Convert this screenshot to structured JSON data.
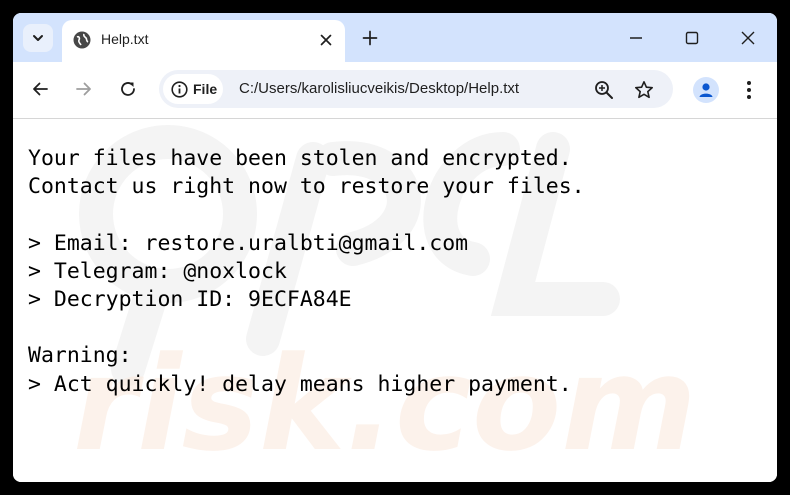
{
  "tab": {
    "title": "Help.txt",
    "icon": "globe-icon"
  },
  "address_bar": {
    "security_chip": "File",
    "url": "C:/Users/karolisliucveikis/Desktop/Help.txt"
  },
  "document": {
    "lines": [
      "Your files have been stolen and encrypted.",
      "Contact us right now to restore your files.",
      "",
      "> Email: restore.uralbti@gmail.com",
      "> Telegram: @noxlock",
      "> Decryption ID: 9ECFA84E",
      "",
      "Warning:",
      "> Act quickly! delay means higher payment."
    ]
  },
  "watermark": {
    "text": "risk.com"
  },
  "colors": {
    "tabstrip_bg": "#d3e3fd",
    "omnibox_bg": "#eef1f8",
    "accent_blue": "#0b57d0",
    "icon_gray": "#474747",
    "watermark": "#f6d7c4"
  }
}
